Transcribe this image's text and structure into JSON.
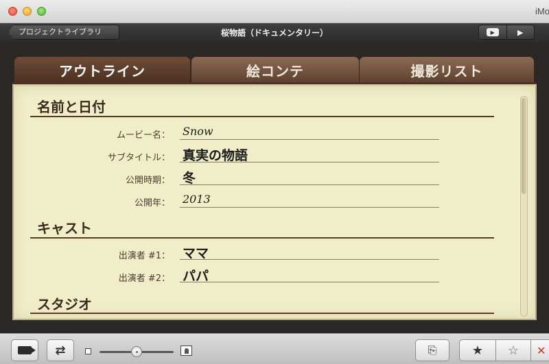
{
  "window": {
    "app_title": "iMovie"
  },
  "toolbar": {
    "back_label": "プロジェクトライブラリ",
    "project_title": "桜物語（ドキュメンタリー）",
    "play_icon": "play-icon"
  },
  "tabs": [
    {
      "label": "アウトライン",
      "active": true
    },
    {
      "label": "絵コンテ",
      "active": false
    },
    {
      "label": "撮影リスト",
      "active": false
    }
  ],
  "sections": [
    {
      "title": "名前と日付"
    },
    {
      "title": "キャスト"
    },
    {
      "title": "スタジオ"
    }
  ],
  "fields": {
    "movie_name": {
      "label": "ムービー名：",
      "value": "Snow"
    },
    "subtitle": {
      "label": "サブタイトル：",
      "value": "真実の物語"
    },
    "release_season": {
      "label": "公開時期：",
      "value": "冬"
    },
    "release_year": {
      "label": "公開年：",
      "value": "2013"
    },
    "cast_1": {
      "label": "出演者 #1：",
      "value": "ママ"
    },
    "cast_2": {
      "label": "出演者 #2：",
      "value": "パパ"
    }
  },
  "bottombar": {
    "camera_icon": "camera-icon",
    "swap_icon": "swap-icon",
    "favorite_glyph": "★",
    "unfavorite_glyph": "☆",
    "reject_glyph": "✕",
    "share_glyph": "⎘",
    "swap_glyph": "⇄"
  },
  "colors": {
    "tab_brown": "#5b4030",
    "paper": "#efeec8",
    "rule": "#5b3a24"
  }
}
